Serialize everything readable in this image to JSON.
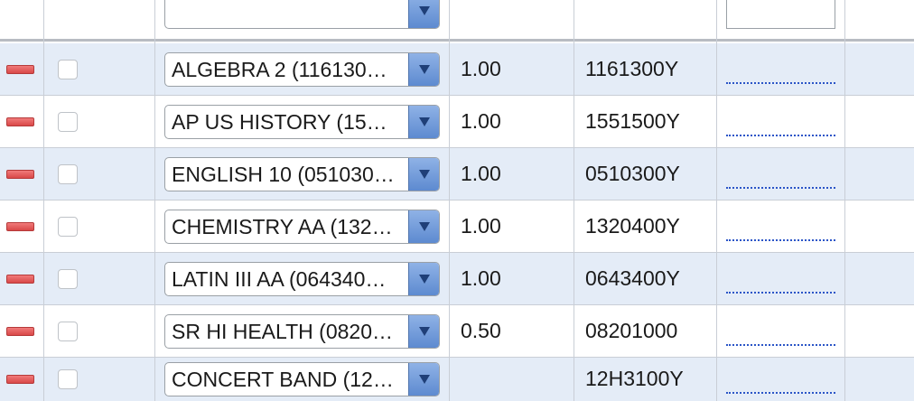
{
  "header": {
    "course_select_value": "",
    "credit_input_value": ""
  },
  "rows": [
    {
      "course": "ALGEBRA 2 (116130…",
      "credits": "1.00",
      "code": "1161300Y"
    },
    {
      "course": "AP US HISTORY (15…",
      "credits": "1.00",
      "code": "1551500Y"
    },
    {
      "course": "ENGLISH 10 (051030…",
      "credits": "1.00",
      "code": "0510300Y"
    },
    {
      "course": "CHEMISTRY AA (132…",
      "credits": "1.00",
      "code": "1320400Y"
    },
    {
      "course": "LATIN III AA (064340…",
      "credits": "1.00",
      "code": "0643400Y"
    },
    {
      "course": "SR HI HEALTH (0820…",
      "credits": "0.50",
      "code": "08201000"
    },
    {
      "course": "CONCERT BAND (12…",
      "credits": "",
      "code": "12H3100Y"
    }
  ],
  "colors": {
    "shaded_row": "#e4ecf7",
    "remove_button": "#d94848",
    "dropdown_arrow": "#5d8ad0",
    "link_dots": "#2b55c7"
  },
  "icons": {
    "remove": "remove-minus-icon",
    "dropdown": "chevron-down-icon"
  }
}
